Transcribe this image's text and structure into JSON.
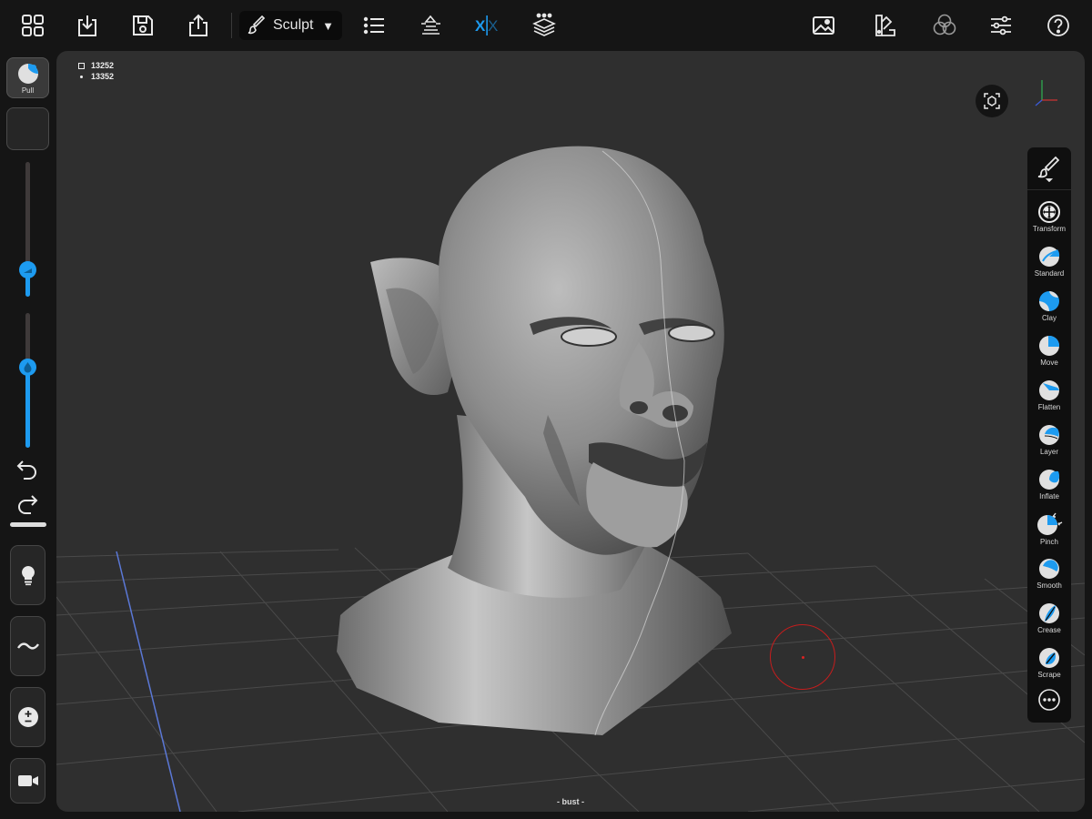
{
  "toolbar": {
    "mode_label": "Sculpt"
  },
  "stats": {
    "faces": "13252",
    "vertices": "13352"
  },
  "left_tool": {
    "label": "Pull"
  },
  "viewport": {
    "object_name": "- bust -"
  },
  "sliders": {
    "radius": 0.2,
    "intensity": 0.6
  },
  "brushes": [
    {
      "label": "Transform",
      "icon": "transform-icon"
    },
    {
      "label": "Standard",
      "icon": "standard-brush-icon"
    },
    {
      "label": "Clay",
      "icon": "clay-brush-icon"
    },
    {
      "label": "Move",
      "icon": "move-brush-icon"
    },
    {
      "label": "Flatten",
      "icon": "flatten-brush-icon"
    },
    {
      "label": "Layer",
      "icon": "layer-brush-icon"
    },
    {
      "label": "Inflate",
      "icon": "inflate-brush-icon"
    },
    {
      "label": "Pinch",
      "icon": "pinch-brush-icon"
    },
    {
      "label": "Smooth",
      "icon": "smooth-brush-icon"
    },
    {
      "label": "Crease",
      "icon": "crease-brush-icon"
    },
    {
      "label": "Scrape",
      "icon": "scrape-brush-icon"
    }
  ],
  "colors": {
    "accent": "#1d9bf0",
    "background": "#151515",
    "viewport": "#2f2f2f",
    "cursor": "#c61d1d"
  }
}
